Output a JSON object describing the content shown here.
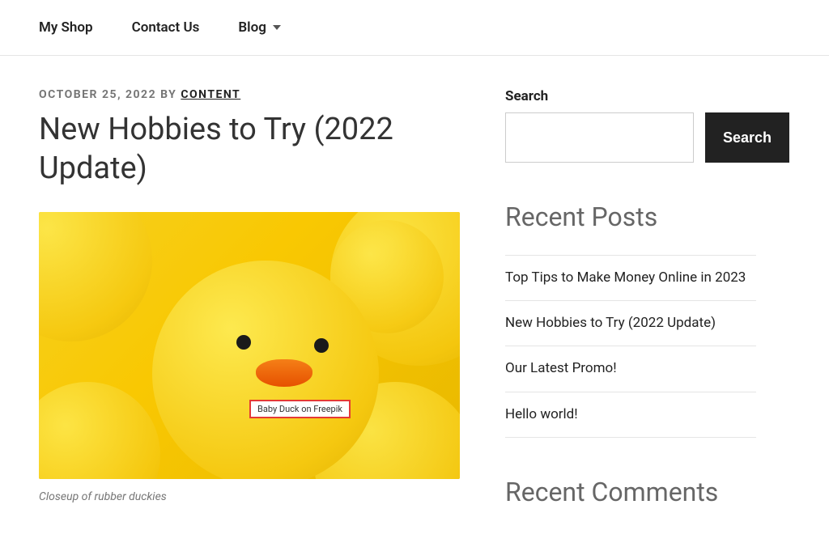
{
  "nav": {
    "items": [
      {
        "label": "My Shop"
      },
      {
        "label": "Contact Us"
      },
      {
        "label": "Blog"
      }
    ]
  },
  "post": {
    "date": "OCTOBER 25, 2022",
    "by_label": " BY ",
    "author": "CONTENT",
    "title": "New Hobbies to Try (2022 Update)",
    "image_tooltip": "Baby Duck on Freepik",
    "caption": "Closeup of rubber duckies"
  },
  "sidebar": {
    "search_label": "Search",
    "search_button": "Search",
    "recent_posts_title": "Recent Posts",
    "recent_posts": [
      {
        "title": "Top Tips to Make Money Online in 2023"
      },
      {
        "title": "New Hobbies to Try (2022 Update)"
      },
      {
        "title": "Our Latest Promo!"
      },
      {
        "title": "Hello world!"
      }
    ],
    "recent_comments_title": "Recent Comments"
  }
}
